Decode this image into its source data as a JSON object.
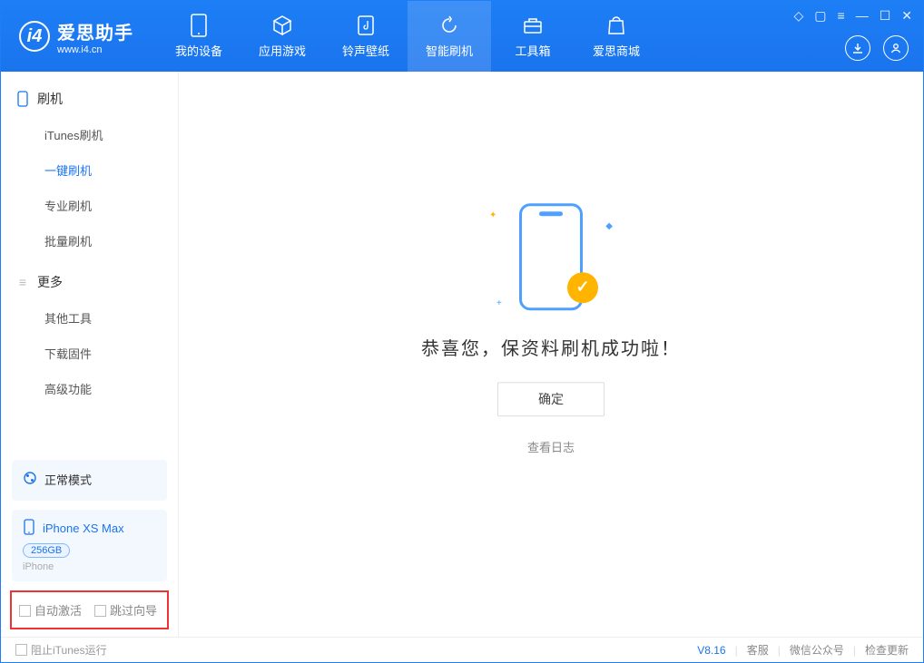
{
  "app": {
    "title": "爱思助手",
    "subtitle": "www.i4.cn"
  },
  "nav": [
    {
      "label": "我的设备",
      "icon": "device"
    },
    {
      "label": "应用游戏",
      "icon": "cube"
    },
    {
      "label": "铃声壁纸",
      "icon": "music"
    },
    {
      "label": "智能刷机",
      "icon": "refresh",
      "active": true
    },
    {
      "label": "工具箱",
      "icon": "toolbox"
    },
    {
      "label": "爱思商城",
      "icon": "bag"
    }
  ],
  "sidebar": {
    "section1": {
      "title": "刷机"
    },
    "items1": [
      {
        "label": "iTunes刷机"
      },
      {
        "label": "一键刷机",
        "active": true
      },
      {
        "label": "专业刷机"
      },
      {
        "label": "批量刷机"
      }
    ],
    "section2": {
      "title": "更多"
    },
    "items2": [
      {
        "label": "其他工具"
      },
      {
        "label": "下载固件"
      },
      {
        "label": "高级功能"
      }
    ]
  },
  "mode": {
    "label": "正常模式"
  },
  "device": {
    "name": "iPhone XS Max",
    "capacity": "256GB",
    "type": "iPhone"
  },
  "checkboxes": {
    "auto_activate": "自动激活",
    "skip_guide": "跳过向导"
  },
  "main": {
    "success_text": "恭喜您，保资料刷机成功啦！",
    "ok_button": "确定",
    "view_log": "查看日志"
  },
  "footer": {
    "block_itunes": "阻止iTunes运行",
    "version": "V8.16",
    "links": [
      "客服",
      "微信公众号",
      "检查更新"
    ]
  }
}
